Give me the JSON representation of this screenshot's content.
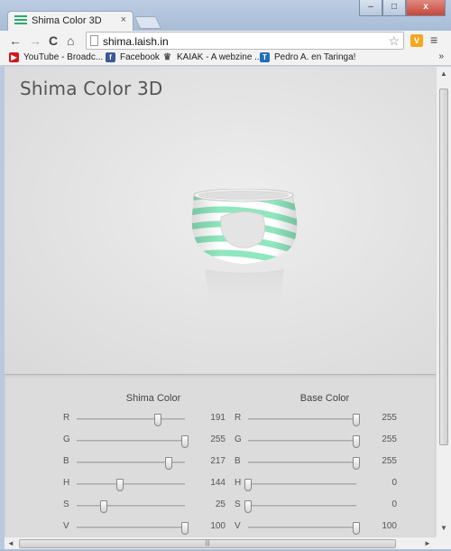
{
  "browser": {
    "tab_title": "Shima Color 3D",
    "tab_close": "×",
    "url": "shima.laish.in",
    "nav": {
      "back": "←",
      "forward": "→",
      "reload": "C",
      "home": "⌂"
    },
    "star": "☆",
    "ext_label": "V",
    "menu": "≡",
    "window": {
      "minimize": "–",
      "maximize": "□",
      "close": "x"
    }
  },
  "bookmarks": {
    "items": [
      {
        "label": "YouTube - Broadc...",
        "icon": "youtube-icon",
        "color": "#cc181e",
        "glyph": "▶"
      },
      {
        "label": "Facebook",
        "icon": "facebook-icon",
        "color": "#3b5998",
        "glyph": "f"
      },
      {
        "label": "KAIAK - A webzine ...",
        "icon": "crown-icon",
        "color": "#555555",
        "glyph": "♛"
      },
      {
        "label": "Pedro A. en Taringa!",
        "icon": "taringa-icon",
        "color": "#1e6fb8",
        "glyph": "T"
      }
    ],
    "more": "»"
  },
  "page": {
    "title": "Shima Color 3D",
    "ring": {
      "stripe_color": "#90e6bf",
      "base_color": "#ffffff"
    }
  },
  "controls": {
    "shima": {
      "title": "Shima Color",
      "rows": [
        {
          "label": "R",
          "value": "191",
          "fraction": 0.749
        },
        {
          "label": "G",
          "value": "255",
          "fraction": 1.0
        },
        {
          "label": "B",
          "value": "217",
          "fraction": 0.851
        },
        {
          "label": "H",
          "value": "144",
          "fraction": 0.4
        },
        {
          "label": "S",
          "value": "25",
          "fraction": 0.25
        },
        {
          "label": "V",
          "value": "100",
          "fraction": 1.0
        }
      ]
    },
    "base": {
      "title": "Base Color",
      "rows": [
        {
          "label": "R",
          "value": "255",
          "fraction": 1.0
        },
        {
          "label": "G",
          "value": "255",
          "fraction": 1.0
        },
        {
          "label": "B",
          "value": "255",
          "fraction": 1.0
        },
        {
          "label": "H",
          "value": "0",
          "fraction": 0.0
        },
        {
          "label": "S",
          "value": "0",
          "fraction": 0.0
        },
        {
          "label": "V",
          "value": "100",
          "fraction": 1.0
        }
      ]
    }
  },
  "scrollbars": {
    "up": "▲",
    "down": "▼",
    "left": "◄",
    "right": "►",
    "grip": "|||"
  }
}
